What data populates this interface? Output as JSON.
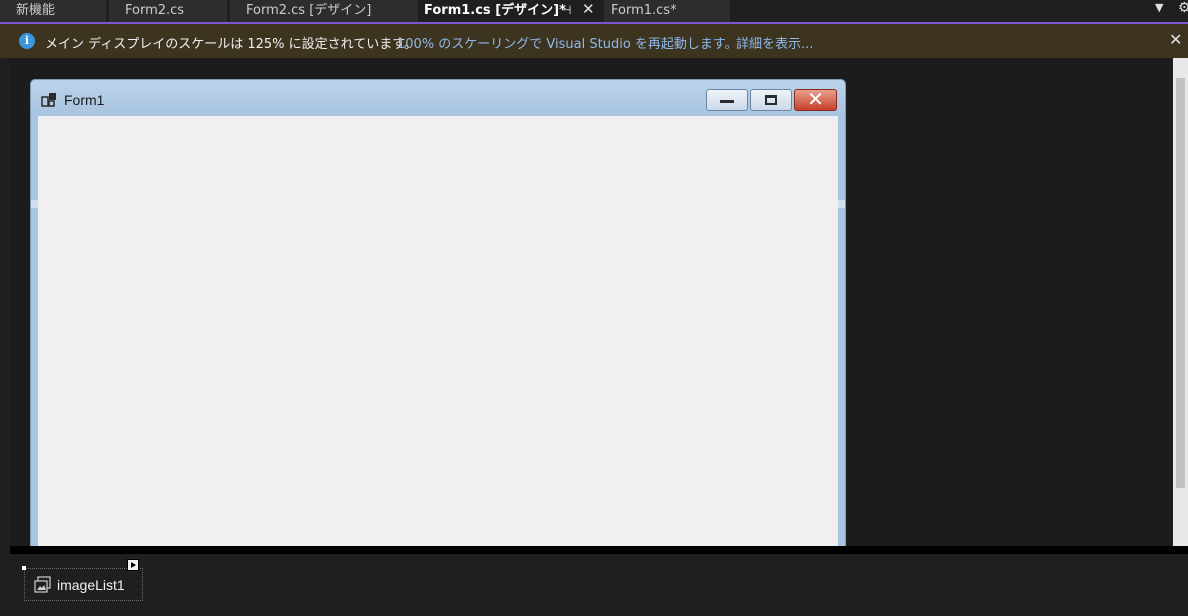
{
  "tabs": [
    {
      "label": "新機能",
      "active": false
    },
    {
      "label": "Form2.cs",
      "active": false
    },
    {
      "label": "Form2.cs [デザイン]",
      "active": false
    },
    {
      "label": "Form1.cs [デザイン]*",
      "active": true
    },
    {
      "label": "Form1.cs*",
      "active": false
    }
  ],
  "tab_icons": {
    "pin": "pin-icon",
    "close": "close-icon",
    "overflow": "chevron-down-icon",
    "settings": "gear-icon"
  },
  "tab_glyphs": {
    "pin": "⊣",
    "close": "✕",
    "overflow": "▼",
    "settings": "⚙"
  },
  "infobar": {
    "icon": "info-icon",
    "icon_glyph": "i",
    "message": "メイン ディスプレイのスケールは 125% に設定されています。",
    "restart_link": "100% のスケーリングで Visual Studio を再起動します。",
    "details_link": "詳細を表示...",
    "close_glyph": "✕",
    "background": "#3d3420",
    "link_color": "#8fb8ea"
  },
  "form": {
    "title": "Form1",
    "close_glyph": "✕",
    "client_color": "#f0f0f0",
    "frame_color": "#a8c4e0"
  },
  "tray": {
    "component_label": "imageList1",
    "component_icon": "image-list-icon"
  },
  "colors": {
    "accent": "#7b55d6",
    "editor_bg": "#1f1f1f"
  }
}
